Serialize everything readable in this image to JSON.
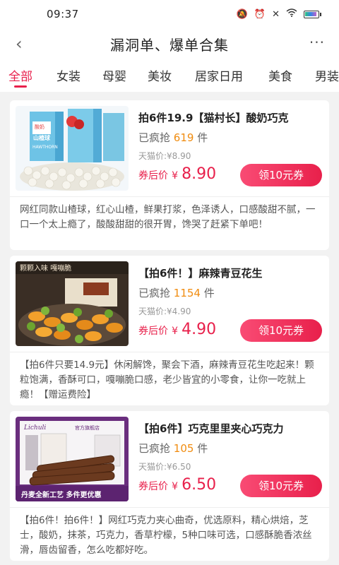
{
  "status_bar": {
    "time": "09:37"
  },
  "navbar": {
    "back": "‹",
    "title": "漏洞单、爆单合集",
    "more": "···"
  },
  "tabs": [
    "全部",
    "女装",
    "母婴",
    "美妆",
    "居家日用",
    "美食",
    "男装"
  ],
  "labels": {
    "sold_prefix": "已疯抢",
    "sold_suffix": "件",
    "tmall_prefix": "天猫价:",
    "after_coupon": "券后价",
    "currency": "¥"
  },
  "products": [
    {
      "title": "拍6件19.9【猫村长】酸奶巧克",
      "sold": "619",
      "tmall_price": "¥8.90",
      "price": "8.90",
      "coupon_label": "领10元券",
      "description": "网红同款山楂球，红心山楂，鲜果打浆，色泽诱人，口感酸甜不腻，一口一个太上瘾了，酸酸甜甜的很开胃，馋哭了赶紧下单吧！",
      "image_text": [
        "酸奶",
        "山楂球",
        "HAWTHORN"
      ]
    },
    {
      "title": "【拍6件！】麻辣青豆花生",
      "sold": "1154",
      "tmall_price": "¥4.90",
      "price": "4.90",
      "coupon_label": "领10元券",
      "description": "【拍6件只要14.9元】休闲解馋，聚会下酒，麻辣青豆花生吃起来！颗粒饱满，香酥可口，嘎嘣脆口感，老少皆宜的小零食，让你一吃就上瘾！【赠运费险】",
      "image_text": [
        "颗颗入味 嘎嘣脆"
      ]
    },
    {
      "title": "【拍6件】巧克里里夹心巧克力",
      "sold": "105",
      "tmall_price": "¥6.50",
      "price": "6.50",
      "coupon_label": "领10元券",
      "description": "【拍6件！拍6件！】网红巧克力夹心曲奇，优选原料，精心烘焙，芝士，酸奶，抹茶，巧克力，香草柠檬，5种口味可选，口感酥脆香浓丝滑，唇齿留香，怎么吃都好吃。",
      "image_text": [
        "官方旗舰店",
        "丹麦全新工艺 多件更优惠"
      ]
    }
  ]
}
